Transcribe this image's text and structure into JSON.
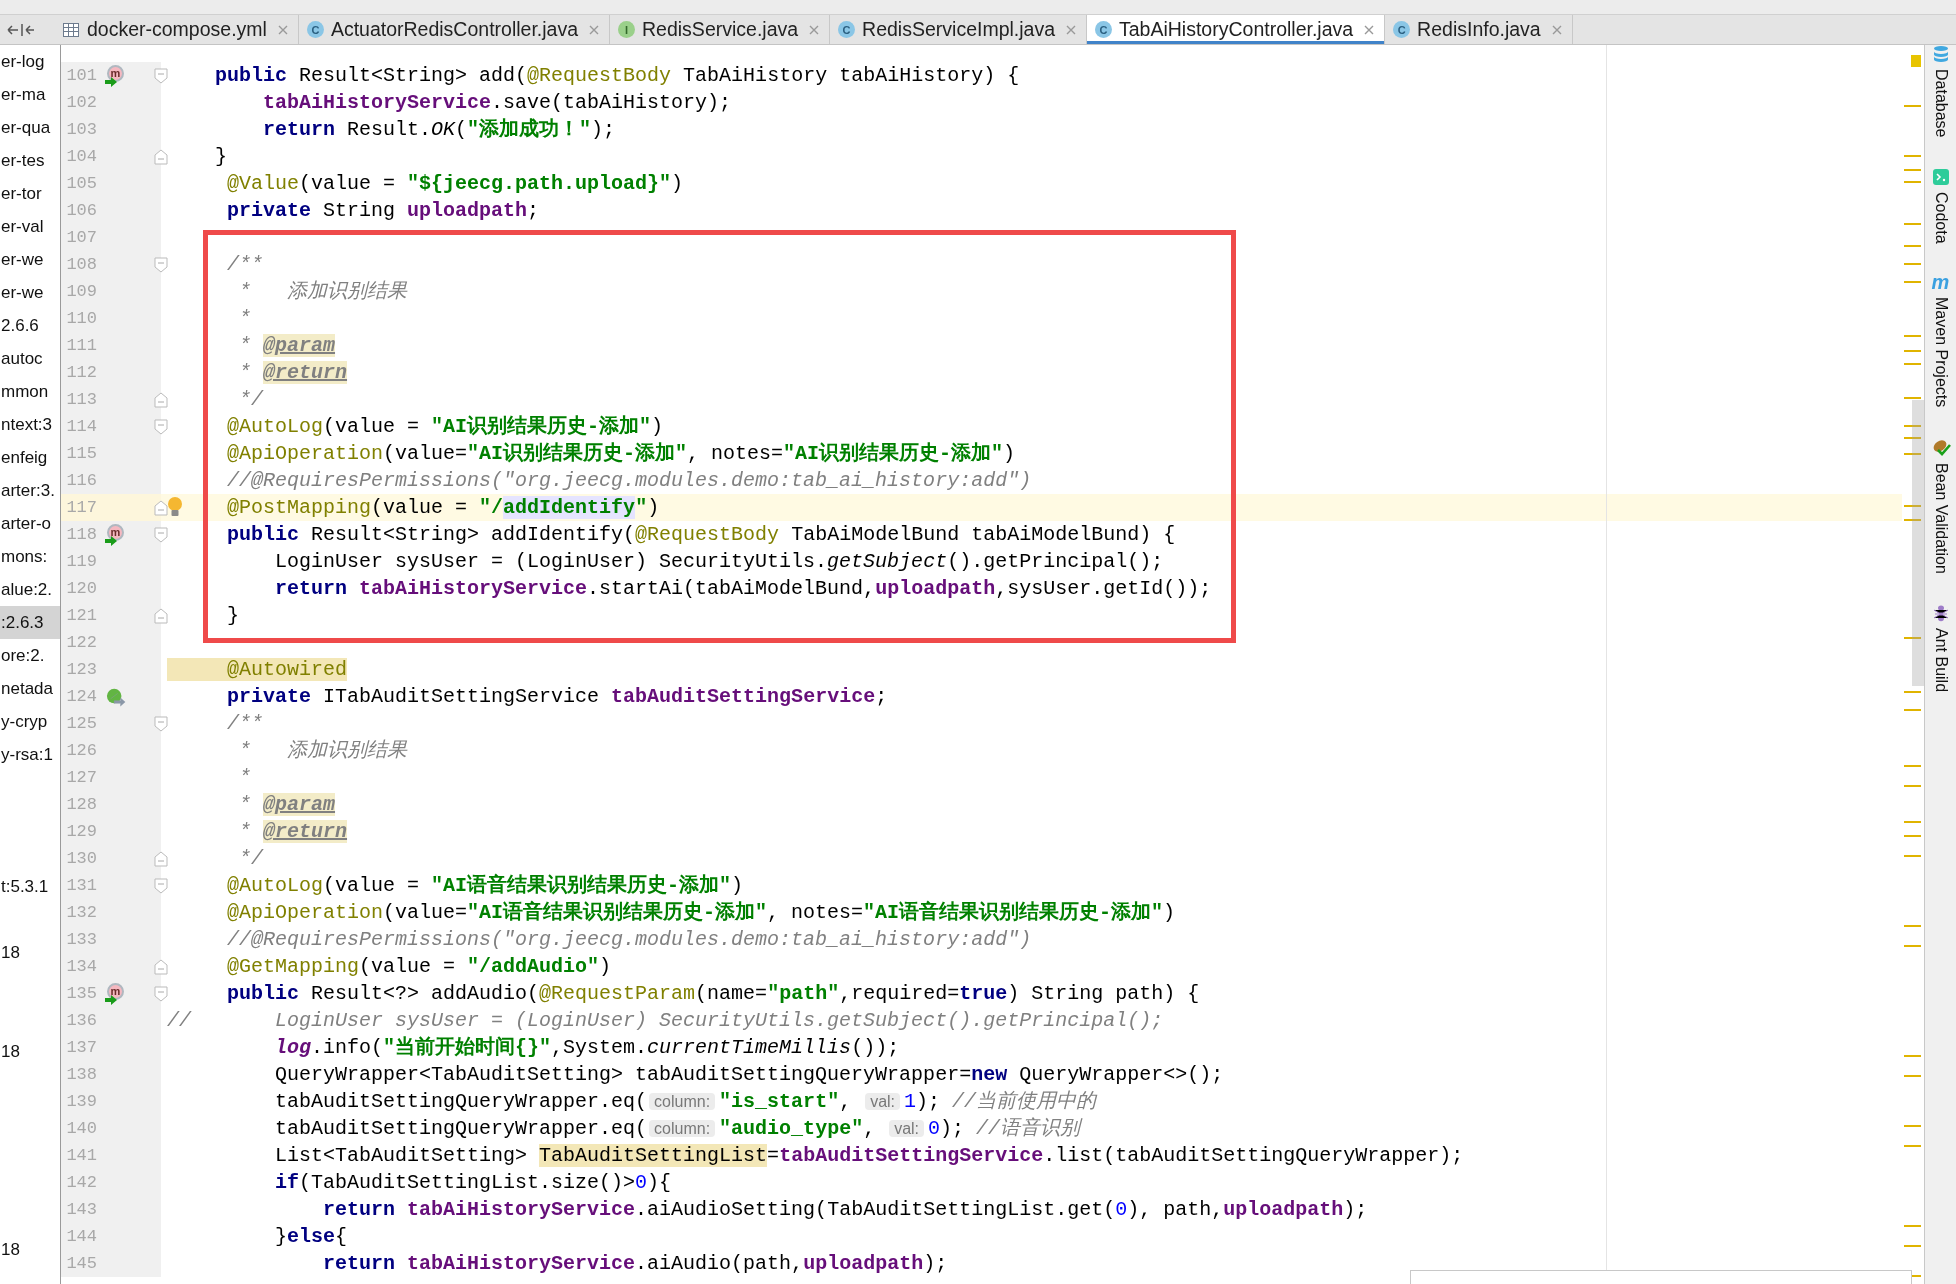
{
  "tabs": [
    {
      "label": "docker-compose.yml",
      "kind": "yaml",
      "selected": false
    },
    {
      "label": "ActuatorRedisController.java",
      "kind": "class",
      "icon_letter": "C",
      "selected": false
    },
    {
      "label": "RedisService.java",
      "kind": "interface",
      "icon_letter": "I",
      "selected": false
    },
    {
      "label": "RedisServiceImpl.java",
      "kind": "class",
      "icon_letter": "C",
      "selected": false
    },
    {
      "label": "TabAiHistoryController.java",
      "kind": "class",
      "icon_letter": "C",
      "selected": true
    },
    {
      "label": "RedisInfo.java",
      "kind": "class",
      "icon_letter": "C",
      "selected": false
    }
  ],
  "project_tree": [
    {
      "kind": "node",
      "text": "er-log",
      "selected": false
    },
    {
      "kind": "node",
      "text": "er-ma",
      "selected": false
    },
    {
      "kind": "node",
      "text": "er-qua",
      "selected": false
    },
    {
      "kind": "node",
      "text": "er-tes",
      "selected": false
    },
    {
      "kind": "node",
      "text": "er-tor",
      "selected": false
    },
    {
      "kind": "node",
      "text": "er-val",
      "selected": false
    },
    {
      "kind": "node",
      "text": "er-we",
      "selected": false
    },
    {
      "kind": "node",
      "text": "er-we",
      "selected": false
    },
    {
      "kind": "node",
      "text": "2.6.6",
      "selected": false
    },
    {
      "kind": "node",
      "text": "autoc",
      "selected": false
    },
    {
      "kind": "node",
      "text": "mmon",
      "selected": false
    },
    {
      "kind": "node",
      "text": "ntext:3",
      "selected": false
    },
    {
      "kind": "node",
      "text": "enfeig",
      "selected": false
    },
    {
      "kind": "node",
      "text": "arter:3.",
      "selected": false
    },
    {
      "kind": "node",
      "text": "arter-o",
      "selected": false
    },
    {
      "kind": "node",
      "text": "mons:",
      "selected": false
    },
    {
      "kind": "node",
      "text": "alue:2.",
      "selected": false
    },
    {
      "kind": "node",
      "text": ":2.6.3",
      "selected": true
    },
    {
      "kind": "node",
      "text": "ore:2.",
      "selected": false
    },
    {
      "kind": "node",
      "text": "netada",
      "selected": false
    },
    {
      "kind": "node",
      "text": "y-cryp",
      "selected": false
    },
    {
      "kind": "node",
      "text": "y-rsa:1",
      "selected": false
    },
    {
      "kind": "blank"
    },
    {
      "kind": "blank"
    },
    {
      "kind": "blank"
    },
    {
      "kind": "node",
      "text": "t:5.3.1",
      "selected": false
    },
    {
      "kind": "blank"
    },
    {
      "kind": "node",
      "text": "18",
      "selected": false
    },
    {
      "kind": "blank"
    },
    {
      "kind": "blank"
    },
    {
      "kind": "node",
      "text": "18",
      "selected": false
    },
    {
      "kind": "blank"
    },
    {
      "kind": "blank"
    },
    {
      "kind": "blank"
    },
    {
      "kind": "blank"
    },
    {
      "kind": "blank"
    },
    {
      "kind": "node",
      "text": "18",
      "selected": false
    }
  ],
  "editor": {
    "blocks": [
      {
        "kind": "plain",
        "lines": [
          {
            "number": "101",
            "current": false,
            "marker": {
              "kind": "override",
              "letter": "m"
            },
            "fold": {
              "kind": "start"
            },
            "tokens": [
              {
                "kind": "keyword",
                "text": "    public"
              },
              {
                "kind": "plain",
                "text": " Result<String> add("
              },
              {
                "kind": "annotation",
                "text": "@RequestBody"
              },
              {
                "kind": "plain",
                "text": " TabAiHistory tabAiHistory) {"
              }
            ]
          },
          {
            "number": "102",
            "current": false,
            "tokens": [
              {
                "kind": "field",
                "text": "        tabAiHistoryService"
              },
              {
                "kind": "plain",
                "text": ".save(tabAiHistory);"
              }
            ]
          },
          {
            "number": "103",
            "current": false,
            "tokens": [
              {
                "kind": "keyword",
                "text": "        return"
              },
              {
                "kind": "plain",
                "text": " Result."
              },
              {
                "kind": "static",
                "text": "OK"
              },
              {
                "kind": "plain",
                "text": "("
              },
              {
                "kind": "string",
                "text": "\"添加成功！\""
              },
              {
                "kind": "plain",
                "text": ");"
              }
            ]
          },
          {
            "number": "104",
            "current": false,
            "fold": {
              "kind": "end"
            },
            "tokens": [
              {
                "kind": "plain",
                "text": "    }"
              }
            ]
          },
          {
            "number": "105",
            "current": false,
            "tokens": [
              {
                "kind": "annotation",
                "text": "     @Value"
              },
              {
                "kind": "plain",
                "text": "(value = "
              },
              {
                "kind": "string",
                "text": "\"${jeecg.path.upload}\""
              },
              {
                "kind": "plain",
                "text": ")"
              }
            ]
          },
          {
            "number": "106",
            "current": false,
            "tokens": [
              {
                "kind": "keyword",
                "text": "     private"
              },
              {
                "kind": "plain",
                "text": " String "
              },
              {
                "kind": "field",
                "text": "uploadpath"
              },
              {
                "kind": "plain",
                "text": ";"
              }
            ]
          }
        ]
      },
      {
        "kind": "boxed",
        "lines": [
          {
            "number": "107",
            "current": false
          },
          {
            "number": "108",
            "current": false,
            "fold": {
              "kind": "start"
            },
            "tokens": [
              {
                "kind": "doc",
                "text": "     /**"
              }
            ]
          },
          {
            "number": "109",
            "current": false,
            "tokens": [
              {
                "kind": "doc",
                "text": "      *   添加识别结果"
              }
            ]
          },
          {
            "number": "110",
            "current": false,
            "tokens": [
              {
                "kind": "doc",
                "text": "      *"
              }
            ]
          },
          {
            "number": "111",
            "current": false,
            "tokens": [
              {
                "kind": "doc",
                "text": "      * "
              },
              {
                "kind": "doc_tag",
                "text": "@param"
              }
            ]
          },
          {
            "number": "112",
            "current": false,
            "tokens": [
              {
                "kind": "doc",
                "text": "      * "
              },
              {
                "kind": "doc_tag",
                "text": "@return"
              }
            ]
          },
          {
            "number": "113",
            "current": false,
            "fold": {
              "kind": "end"
            },
            "tokens": [
              {
                "kind": "doc",
                "text": "      */"
              }
            ]
          },
          {
            "number": "114",
            "current": false,
            "fold": {
              "kind": "start"
            },
            "tokens": [
              {
                "kind": "annotation",
                "text": "     @AutoLog"
              },
              {
                "kind": "plain",
                "text": "(value = "
              },
              {
                "kind": "string",
                "text": "\"AI识别结果历史-添加\""
              },
              {
                "kind": "plain",
                "text": ")"
              }
            ]
          },
          {
            "number": "115",
            "current": false,
            "tokens": [
              {
                "kind": "annotation",
                "text": "     @ApiOperation"
              },
              {
                "kind": "plain",
                "text": "(value="
              },
              {
                "kind": "string",
                "text": "\"AI识别结果历史-添加\""
              },
              {
                "kind": "plain",
                "text": ", notes="
              },
              {
                "kind": "string",
                "text": "\"AI识别结果历史-添加\""
              },
              {
                "kind": "plain",
                "text": ")"
              }
            ]
          },
          {
            "number": "116",
            "current": false,
            "tokens": [
              {
                "kind": "comment",
                "text": "     //@RequiresPermissions(\"org.jeecg.modules.demo:tab_ai_history:add\")"
              }
            ]
          },
          {
            "number": "117",
            "current": true,
            "marker": {
              "kind": "bulb"
            },
            "fold": {
              "kind": "end"
            },
            "tokens": [
              {
                "kind": "annotation",
                "text": "     @PostMapping"
              },
              {
                "kind": "plain",
                "text": "(value = "
              },
              {
                "kind": "string",
                "text": "\"/"
              },
              {
                "kind": "caret"
              },
              {
                "kind": "string_match",
                "text": "addIdentify"
              },
              {
                "kind": "string",
                "text": "\""
              },
              {
                "kind": "plain",
                "text": ")"
              }
            ]
          },
          {
            "number": "118",
            "current": false,
            "marker": {
              "kind": "override",
              "letter": "m"
            },
            "fold": {
              "kind": "start"
            },
            "tokens": [
              {
                "kind": "keyword",
                "text": "     public"
              },
              {
                "kind": "plain",
                "text": " Result<String> addIdentify("
              },
              {
                "kind": "annotation",
                "text": "@RequestBody"
              },
              {
                "kind": "plain",
                "text": " TabAiModelBund tabAiModelBund) {"
              }
            ]
          },
          {
            "number": "119",
            "current": false,
            "tokens": [
              {
                "kind": "plain",
                "text": "         LoginUser sysUser = (LoginUser) SecurityUtils."
              },
              {
                "kind": "static",
                "text": "getSubject"
              },
              {
                "kind": "plain",
                "text": "().getPrincipal();"
              }
            ]
          },
          {
            "number": "120",
            "current": false,
            "tokens": [
              {
                "kind": "keyword",
                "text": "         return"
              },
              {
                "kind": "field",
                "text": " tabAiHistoryService"
              },
              {
                "kind": "plain",
                "text": ".startAi(tabAiModelBund,"
              },
              {
                "kind": "field",
                "text": "uploadpath"
              },
              {
                "kind": "plain",
                "text": ",sysUser.getId());"
              }
            ]
          },
          {
            "number": "121",
            "current": false,
            "fold": {
              "kind": "end"
            },
            "tokens": [
              {
                "kind": "plain",
                "text": "     }"
              }
            ]
          }
        ]
      },
      {
        "kind": "plain",
        "lines": [
          {
            "number": "122",
            "current": false
          },
          {
            "number": "123",
            "current": false,
            "tokens": [
              {
                "kind": "annotation_match",
                "text": "     @Autowired"
              }
            ]
          },
          {
            "number": "124",
            "current": false,
            "marker": {
              "kind": "autowired"
            },
            "tokens": [
              {
                "kind": "keyword",
                "text": "     private"
              },
              {
                "kind": "plain",
                "text": " ITabAuditSettingService "
              },
              {
                "kind": "field",
                "text": "tabAuditSettingService"
              },
              {
                "kind": "plain",
                "text": ";"
              }
            ]
          },
          {
            "number": "125",
            "current": false,
            "fold": {
              "kind": "start"
            },
            "tokens": [
              {
                "kind": "doc",
                "text": "     /**"
              }
            ]
          },
          {
            "number": "126",
            "current": false,
            "tokens": [
              {
                "kind": "doc",
                "text": "      *   添加识别结果"
              }
            ]
          },
          {
            "number": "127",
            "current": false,
            "tokens": [
              {
                "kind": "doc",
                "text": "      *"
              }
            ]
          },
          {
            "number": "128",
            "current": false,
            "tokens": [
              {
                "kind": "doc",
                "text": "      * "
              },
              {
                "kind": "doc_tag",
                "text": "@param"
              }
            ]
          },
          {
            "number": "129",
            "current": false,
            "tokens": [
              {
                "kind": "doc",
                "text": "      * "
              },
              {
                "kind": "doc_tag",
                "text": "@return"
              }
            ]
          },
          {
            "number": "130",
            "current": false,
            "fold": {
              "kind": "end"
            },
            "tokens": [
              {
                "kind": "doc",
                "text": "      */"
              }
            ]
          },
          {
            "number": "131",
            "current": false,
            "fold": {
              "kind": "start"
            },
            "tokens": [
              {
                "kind": "annotation",
                "text": "     @AutoLog"
              },
              {
                "kind": "plain",
                "text": "(value = "
              },
              {
                "kind": "string",
                "text": "\"AI语音结果识别结果历史-添加\""
              },
              {
                "kind": "plain",
                "text": ")"
              }
            ]
          },
          {
            "number": "132",
            "current": false,
            "tokens": [
              {
                "kind": "annotation",
                "text": "     @ApiOperation"
              },
              {
                "kind": "plain",
                "text": "(value="
              },
              {
                "kind": "string",
                "text": "\"AI语音结果识别结果历史-添加\""
              },
              {
                "kind": "plain",
                "text": ", notes="
              },
              {
                "kind": "string",
                "text": "\"AI语音结果识别结果历史-添加\""
              },
              {
                "kind": "plain",
                "text": ")"
              }
            ]
          },
          {
            "number": "133",
            "current": false,
            "tokens": [
              {
                "kind": "comment",
                "text": "     //@RequiresPermissions(\"org.jeecg.modules.demo:tab_ai_history:add\")"
              }
            ]
          },
          {
            "number": "134",
            "current": false,
            "fold": {
              "kind": "end"
            },
            "tokens": [
              {
                "kind": "annotation",
                "text": "     @GetMapping"
              },
              {
                "kind": "plain",
                "text": "(value = "
              },
              {
                "kind": "string",
                "text": "\"/addAudio\""
              },
              {
                "kind": "plain",
                "text": ")"
              }
            ]
          },
          {
            "number": "135",
            "current": false,
            "marker": {
              "kind": "override",
              "letter": "m"
            },
            "fold": {
              "kind": "start"
            },
            "tokens": [
              {
                "kind": "keyword",
                "text": "     public"
              },
              {
                "kind": "plain",
                "text": " Result<?> addAudio("
              },
              {
                "kind": "annotation",
                "text": "@RequestParam"
              },
              {
                "kind": "plain",
                "text": "(name="
              },
              {
                "kind": "string",
                "text": "\"path\""
              },
              {
                "kind": "plain",
                "text": ",required="
              },
              {
                "kind": "keyword",
                "text": "true"
              },
              {
                "kind": "plain",
                "text": ") String path) {"
              }
            ]
          },
          {
            "number": "136",
            "current": false,
            "tokens": [
              {
                "kind": "comment",
                "text": "//       LoginUser sysUser = (LoginUser) SecurityUtils.getSubject().getPrincipal();"
              }
            ]
          },
          {
            "number": "137",
            "current": false,
            "tokens": [
              {
                "kind": "static_field",
                "text": "         log"
              },
              {
                "kind": "plain",
                "text": ".info("
              },
              {
                "kind": "string",
                "text": "\"当前开始时间{}\""
              },
              {
                "kind": "plain",
                "text": ",System."
              },
              {
                "kind": "static",
                "text": "currentTimeMillis"
              },
              {
                "kind": "plain",
                "text": "());"
              }
            ]
          },
          {
            "number": "138",
            "current": false,
            "tokens": [
              {
                "kind": "plain",
                "text": "         QueryWrapper<TabAuditSetting> tabAuditSettingQueryWrapper="
              },
              {
                "kind": "keyword",
                "text": "new"
              },
              {
                "kind": "plain",
                "text": " QueryWrapper<>();"
              }
            ]
          },
          {
            "number": "139",
            "current": false,
            "tokens": [
              {
                "kind": "plain",
                "text": "         tabAuditSettingQueryWrapper.eq("
              },
              {
                "kind": "hint",
                "text": "column:"
              },
              {
                "kind": "string",
                "text": "\"is_start\""
              },
              {
                "kind": "plain",
                "text": ", "
              },
              {
                "kind": "hint",
                "text": "val:"
              },
              {
                "kind": "number",
                "text": "1"
              },
              {
                "kind": "plain",
                "text": "); "
              },
              {
                "kind": "comment",
                "text": "//当前使用中的"
              }
            ]
          },
          {
            "number": "140",
            "current": false,
            "tokens": [
              {
                "kind": "plain",
                "text": "         tabAuditSettingQueryWrapper.eq("
              },
              {
                "kind": "hint",
                "text": "column:"
              },
              {
                "kind": "string",
                "text": "\"audio_type\""
              },
              {
                "kind": "plain",
                "text": ", "
              },
              {
                "kind": "hint",
                "text": "val:"
              },
              {
                "kind": "number",
                "text": "0"
              },
              {
                "kind": "plain",
                "text": "); "
              },
              {
                "kind": "comment",
                "text": "//语音识别"
              }
            ]
          },
          {
            "number": "141",
            "current": false,
            "tokens": [
              {
                "kind": "plain",
                "text": "         List<TabAuditSetting> "
              },
              {
                "kind": "variable_match",
                "text": "TabAuditSettingList"
              },
              {
                "kind": "plain",
                "text": "="
              },
              {
                "kind": "field",
                "text": "tabAuditSettingService"
              },
              {
                "kind": "plain",
                "text": ".list(tabAuditSettingQueryWrapper);"
              }
            ]
          },
          {
            "number": "142",
            "current": false,
            "tokens": [
              {
                "kind": "keyword",
                "text": "         if"
              },
              {
                "kind": "plain",
                "text": "(TabAuditSettingList.size()>"
              },
              {
                "kind": "number",
                "text": "0"
              },
              {
                "kind": "plain",
                "text": "){"
              }
            ]
          },
          {
            "number": "143",
            "current": false,
            "tokens": [
              {
                "kind": "keyword",
                "text": "             return"
              },
              {
                "kind": "field",
                "text": " tabAiHistoryService"
              },
              {
                "kind": "plain",
                "text": ".aiAudioSetting(TabAuditSettingList.get("
              },
              {
                "kind": "number",
                "text": "0"
              },
              {
                "kind": "plain",
                "text": "), path,"
              },
              {
                "kind": "field",
                "text": "uploadpath"
              },
              {
                "kind": "plain",
                "text": ");"
              }
            ]
          },
          {
            "number": "144",
            "current": false,
            "tokens": [
              {
                "kind": "plain",
                "text": "         }"
              },
              {
                "kind": "keyword",
                "text": "else"
              },
              {
                "kind": "plain",
                "text": "{"
              }
            ]
          },
          {
            "number": "145",
            "current": false,
            "tokens": [
              {
                "kind": "keyword",
                "text": "             return"
              },
              {
                "kind": "field",
                "text": " tabAiHistoryService"
              },
              {
                "kind": "plain",
                "text": ".aiAudio(path,"
              },
              {
                "kind": "field",
                "text": "uploadpath"
              },
              {
                "kind": "plain",
                "text": ");"
              }
            ]
          }
        ]
      }
    ]
  },
  "tool_windows": [
    {
      "label": "Database",
      "kind": "database"
    },
    {
      "label": "Codota",
      "kind": "codota"
    },
    {
      "label": "Maven Projects",
      "kind": "letter",
      "icon_letter": "m"
    },
    {
      "label": "Bean Validation",
      "kind": "bean"
    },
    {
      "label": "Ant Build",
      "kind": "ant"
    }
  ]
}
